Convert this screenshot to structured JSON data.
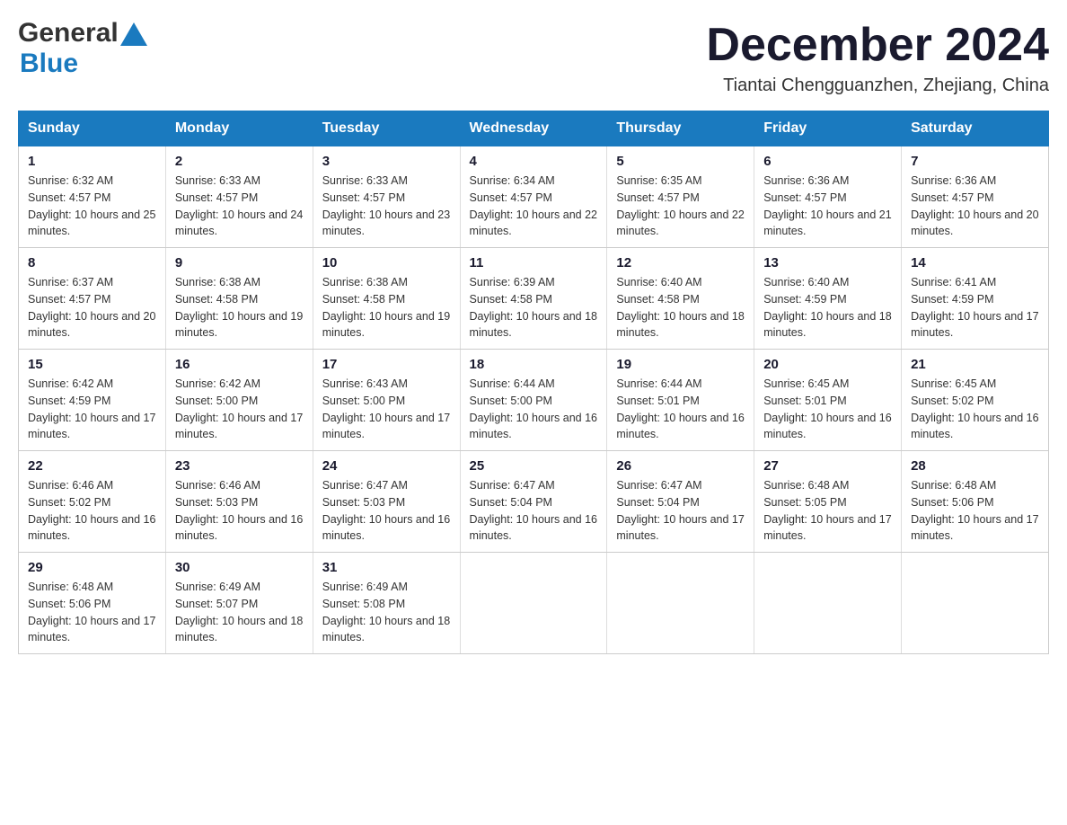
{
  "header": {
    "logo_general": "General",
    "logo_blue": "Blue",
    "month_title": "December 2024",
    "location": "Tiantai Chengguanzhen, Zhejiang, China"
  },
  "days_of_week": [
    "Sunday",
    "Monday",
    "Tuesday",
    "Wednesday",
    "Thursday",
    "Friday",
    "Saturday"
  ],
  "weeks": [
    [
      {
        "day": "1",
        "sunrise": "6:32 AM",
        "sunset": "4:57 PM",
        "daylight": "10 hours and 25 minutes."
      },
      {
        "day": "2",
        "sunrise": "6:33 AM",
        "sunset": "4:57 PM",
        "daylight": "10 hours and 24 minutes."
      },
      {
        "day": "3",
        "sunrise": "6:33 AM",
        "sunset": "4:57 PM",
        "daylight": "10 hours and 23 minutes."
      },
      {
        "day": "4",
        "sunrise": "6:34 AM",
        "sunset": "4:57 PM",
        "daylight": "10 hours and 22 minutes."
      },
      {
        "day": "5",
        "sunrise": "6:35 AM",
        "sunset": "4:57 PM",
        "daylight": "10 hours and 22 minutes."
      },
      {
        "day": "6",
        "sunrise": "6:36 AM",
        "sunset": "4:57 PM",
        "daylight": "10 hours and 21 minutes."
      },
      {
        "day": "7",
        "sunrise": "6:36 AM",
        "sunset": "4:57 PM",
        "daylight": "10 hours and 20 minutes."
      }
    ],
    [
      {
        "day": "8",
        "sunrise": "6:37 AM",
        "sunset": "4:57 PM",
        "daylight": "10 hours and 20 minutes."
      },
      {
        "day": "9",
        "sunrise": "6:38 AM",
        "sunset": "4:58 PM",
        "daylight": "10 hours and 19 minutes."
      },
      {
        "day": "10",
        "sunrise": "6:38 AM",
        "sunset": "4:58 PM",
        "daylight": "10 hours and 19 minutes."
      },
      {
        "day": "11",
        "sunrise": "6:39 AM",
        "sunset": "4:58 PM",
        "daylight": "10 hours and 18 minutes."
      },
      {
        "day": "12",
        "sunrise": "6:40 AM",
        "sunset": "4:58 PM",
        "daylight": "10 hours and 18 minutes."
      },
      {
        "day": "13",
        "sunrise": "6:40 AM",
        "sunset": "4:59 PM",
        "daylight": "10 hours and 18 minutes."
      },
      {
        "day": "14",
        "sunrise": "6:41 AM",
        "sunset": "4:59 PM",
        "daylight": "10 hours and 17 minutes."
      }
    ],
    [
      {
        "day": "15",
        "sunrise": "6:42 AM",
        "sunset": "4:59 PM",
        "daylight": "10 hours and 17 minutes."
      },
      {
        "day": "16",
        "sunrise": "6:42 AM",
        "sunset": "5:00 PM",
        "daylight": "10 hours and 17 minutes."
      },
      {
        "day": "17",
        "sunrise": "6:43 AM",
        "sunset": "5:00 PM",
        "daylight": "10 hours and 17 minutes."
      },
      {
        "day": "18",
        "sunrise": "6:44 AM",
        "sunset": "5:00 PM",
        "daylight": "10 hours and 16 minutes."
      },
      {
        "day": "19",
        "sunrise": "6:44 AM",
        "sunset": "5:01 PM",
        "daylight": "10 hours and 16 minutes."
      },
      {
        "day": "20",
        "sunrise": "6:45 AM",
        "sunset": "5:01 PM",
        "daylight": "10 hours and 16 minutes."
      },
      {
        "day": "21",
        "sunrise": "6:45 AM",
        "sunset": "5:02 PM",
        "daylight": "10 hours and 16 minutes."
      }
    ],
    [
      {
        "day": "22",
        "sunrise": "6:46 AM",
        "sunset": "5:02 PM",
        "daylight": "10 hours and 16 minutes."
      },
      {
        "day": "23",
        "sunrise": "6:46 AM",
        "sunset": "5:03 PM",
        "daylight": "10 hours and 16 minutes."
      },
      {
        "day": "24",
        "sunrise": "6:47 AM",
        "sunset": "5:03 PM",
        "daylight": "10 hours and 16 minutes."
      },
      {
        "day": "25",
        "sunrise": "6:47 AM",
        "sunset": "5:04 PM",
        "daylight": "10 hours and 16 minutes."
      },
      {
        "day": "26",
        "sunrise": "6:47 AM",
        "sunset": "5:04 PM",
        "daylight": "10 hours and 17 minutes."
      },
      {
        "day": "27",
        "sunrise": "6:48 AM",
        "sunset": "5:05 PM",
        "daylight": "10 hours and 17 minutes."
      },
      {
        "day": "28",
        "sunrise": "6:48 AM",
        "sunset": "5:06 PM",
        "daylight": "10 hours and 17 minutes."
      }
    ],
    [
      {
        "day": "29",
        "sunrise": "6:48 AM",
        "sunset": "5:06 PM",
        "daylight": "10 hours and 17 minutes."
      },
      {
        "day": "30",
        "sunrise": "6:49 AM",
        "sunset": "5:07 PM",
        "daylight": "10 hours and 18 minutes."
      },
      {
        "day": "31",
        "sunrise": "6:49 AM",
        "sunset": "5:08 PM",
        "daylight": "10 hours and 18 minutes."
      },
      null,
      null,
      null,
      null
    ]
  ],
  "labels": {
    "sunrise_prefix": "Sunrise: ",
    "sunset_prefix": "Sunset: ",
    "daylight_prefix": "Daylight: "
  }
}
